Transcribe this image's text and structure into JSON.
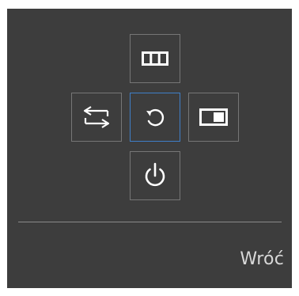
{
  "osd": {
    "buttons": {
      "up": {
        "icon": "menu-columns-icon"
      },
      "left": {
        "icon": "source-switch-arrows-icon"
      },
      "center": {
        "icon": "return-icon",
        "selected": true
      },
      "right": {
        "icon": "picture-in-picture-icon"
      },
      "down": {
        "icon": "power-icon"
      }
    },
    "action_label": "Wróć",
    "colors": {
      "panel_background": "#3d3d3d",
      "button_border": "#767676",
      "selected_border": "#3f7fc8",
      "icon": "#ffffff",
      "label_text": "#d8d8d8"
    }
  }
}
